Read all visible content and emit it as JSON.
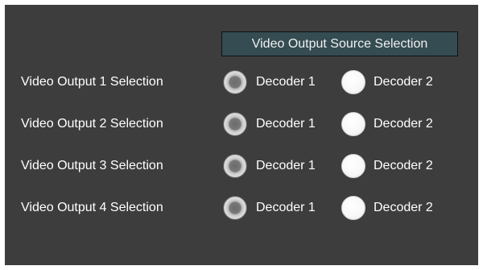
{
  "header": {
    "title": "Video Output Source Selection"
  },
  "rows": [
    {
      "label": "Video Output 1 Selection",
      "option1": "Decoder 1",
      "option2": "Decoder 2",
      "selected": "Decoder 1"
    },
    {
      "label": "Video Output 2 Selection",
      "option1": "Decoder 1",
      "option2": "Decoder 2",
      "selected": "Decoder 1"
    },
    {
      "label": "Video Output 3 Selection",
      "option1": "Decoder 1",
      "option2": "Decoder 2",
      "selected": "Decoder 1"
    },
    {
      "label": "Video Output 4 Selection",
      "option1": "Decoder 1",
      "option2": "Decoder 2",
      "selected": "Decoder 1"
    }
  ],
  "colors": {
    "panel_background": "#3d3d3d",
    "header_background": "#344c52",
    "text": "#ffffff"
  }
}
